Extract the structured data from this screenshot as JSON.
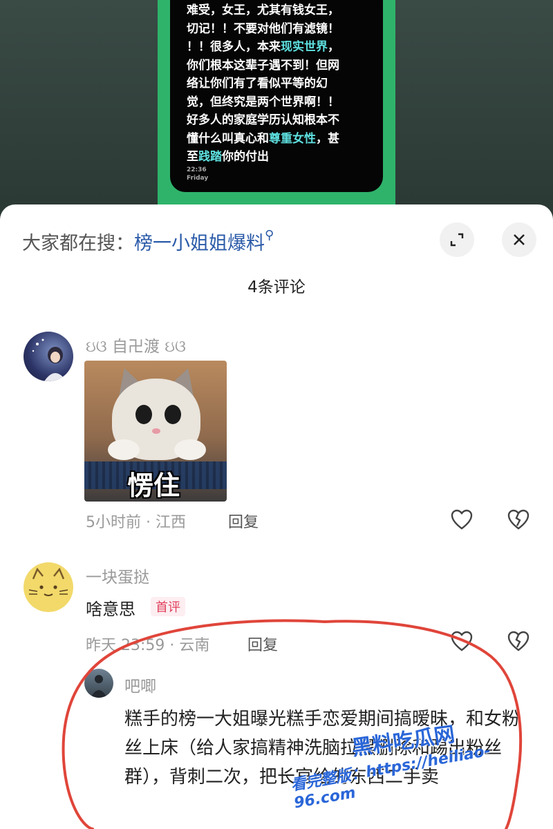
{
  "video": {
    "chat_lines": [
      {
        "segments": [
          {
            "t": "难受，女王，尤其有钱女王，",
            "h": false
          }
        ]
      },
      {
        "segments": [
          {
            "t": "切记！！不要对他们有滤镜！",
            "h": false
          }
        ]
      },
      {
        "segments": [
          {
            "t": "！！很多人，本来",
            "h": false
          },
          {
            "t": "现实世界",
            "h": true
          },
          {
            "t": "，",
            "h": false
          }
        ]
      },
      {
        "segments": [
          {
            "t": "你们根本这辈子遇不到！但网",
            "h": false
          }
        ]
      },
      {
        "segments": [
          {
            "t": "络让你们有了看似平等的幻",
            "h": false
          }
        ]
      },
      {
        "segments": [
          {
            "t": "觉，但终究是两个世界啊！！",
            "h": false
          }
        ]
      },
      {
        "segments": [
          {
            "t": "好多人的家庭学历认知根本不",
            "h": false
          }
        ]
      },
      {
        "segments": [
          {
            "t": "懂什么叫真心和",
            "h": false
          },
          {
            "t": "尊重女性",
            "h": true
          },
          {
            "t": "，甚",
            "h": false
          }
        ]
      },
      {
        "segments": [
          {
            "t": "至",
            "h": false
          },
          {
            "t": "践踏",
            "h": true
          },
          {
            "t": "你的付出",
            "h": false
          }
        ]
      }
    ],
    "time": "22:36",
    "day": "Friday"
  },
  "sheet": {
    "search_prefix": "大家都在搜：",
    "search_keyword": "榜一小姐姐爆料",
    "comment_count": "4条评论"
  },
  "comments": [
    {
      "username": "ઇଓ 自卍渡 ઇଓ",
      "sticker_caption": "愣住",
      "meta": "5小时前 · 江西",
      "reply_label": "回复"
    },
    {
      "username": "一块蛋挞",
      "text": "啥意思",
      "badge": "首评",
      "meta": "昨天 23:59 · 云南",
      "reply_label": "回复"
    }
  ],
  "sub_reply": {
    "username": "吧唧",
    "text": "糕手的榜一大姐曝光糕手恋爱期间搞暧昧，和女粉丝上床（给人家搞精神洗脑拉黑删除和踢出粉丝群），背刺二次，把长官给的东西二手卖"
  },
  "watermark": {
    "line1": "黑料吃瓜网",
    "line2": "看完整版：https://heiliao-96.com"
  },
  "colors": {
    "highlight": "#5ee0e0",
    "keyword": "#2a5aa8",
    "badge": "#e0405c",
    "annotation": "#e0453a",
    "watermark": "#2a66d8"
  }
}
